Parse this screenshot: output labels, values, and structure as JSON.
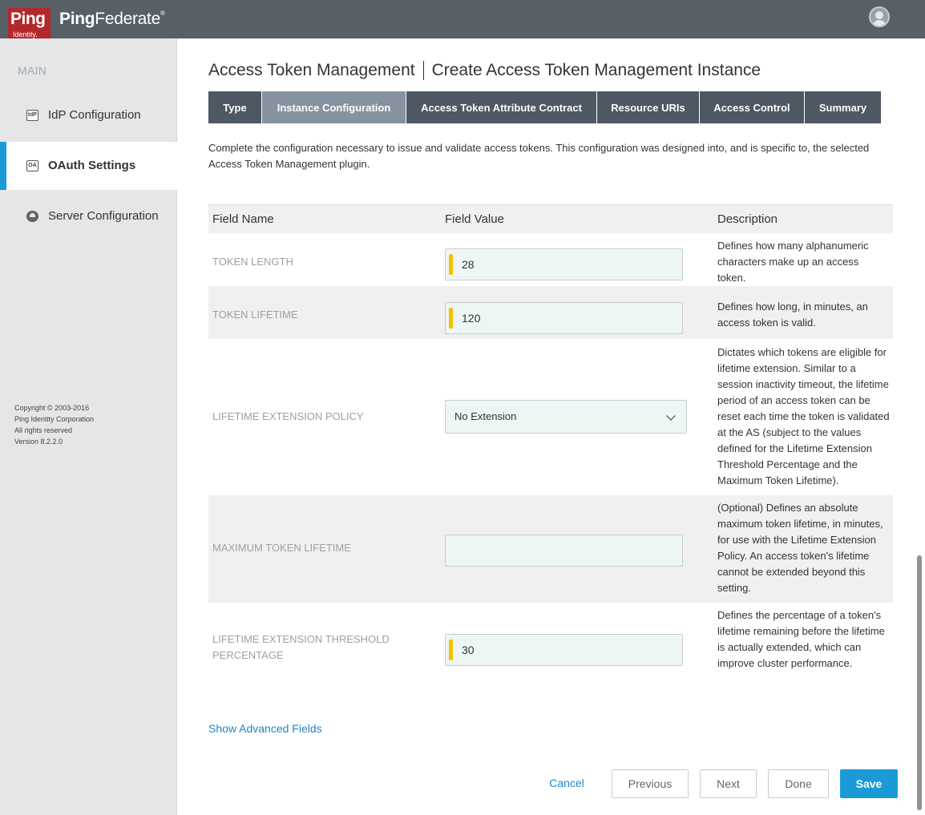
{
  "header": {
    "logo_big": "Ping",
    "logo_small": "Identity.",
    "product_bold": "Ping",
    "product_rest": "Federate",
    "product_mark": "®"
  },
  "sidebar": {
    "section": "MAIN",
    "items": [
      {
        "label": "IdP Configuration",
        "icon": "IdP"
      },
      {
        "label": "OAuth Settings",
        "icon": "OA"
      },
      {
        "label": "Server Configuration",
        "icon": ""
      }
    ],
    "copyright": [
      "Copyright © 2003-2016",
      "Ping Identity Corporation",
      "All rights reserved",
      "Version 8.2.2.0"
    ]
  },
  "page": {
    "title_left": "Access Token Management",
    "title_right": "Create Access Token Management Instance",
    "intro": "Complete the configuration necessary to issue and validate access tokens. This configuration was designed into, and is specific to, the selected Access Token Management plugin."
  },
  "tabs": [
    "Type",
    "Instance Configuration",
    "Access Token Attribute Contract",
    "Resource URIs",
    "Access Control",
    "Summary"
  ],
  "table": {
    "headers": [
      "Field Name",
      "Field Value",
      "Description"
    ],
    "rows": [
      {
        "name": "TOKEN LENGTH",
        "value": "28",
        "desc": "Defines how many alphanumeric characters make up an access token."
      },
      {
        "name": "TOKEN LIFETIME",
        "value": "120",
        "desc": "Defines how long, in minutes, an access token is valid."
      },
      {
        "name": "LIFETIME EXTENSION POLICY",
        "value": "No Extension",
        "desc": "Dictates which tokens are eligible for lifetime extension. Similar to a session inactivity timeout, the lifetime period of an access token can be reset each time the token is validated at the AS (subject to the values defined for the Lifetime Extension Threshold Percentage and the Maximum Token Lifetime)."
      },
      {
        "name": "MAXIMUM TOKEN LIFETIME",
        "value": "",
        "desc": "(Optional) Defines an absolute maximum token lifetime, in minutes, for use with the Lifetime Extension Policy. An access token's lifetime cannot be extended beyond this setting."
      },
      {
        "name": "LIFETIME EXTENSION THRESHOLD PERCENTAGE",
        "value": "30",
        "desc": "Defines the percentage of a token's lifetime remaining before the lifetime is actually extended, which can improve cluster performance."
      }
    ]
  },
  "advanced_link": "Show Advanced Fields",
  "buttons": {
    "cancel": "Cancel",
    "previous": "Previous",
    "next": "Next",
    "done": "Done",
    "save": "Save"
  },
  "colors": {
    "accent": "#1a9bd7",
    "header": "#575f67",
    "tab": "#4d5863",
    "tab_active": "#8592a0",
    "required": "#f4c000",
    "logo": "#b3282d"
  }
}
